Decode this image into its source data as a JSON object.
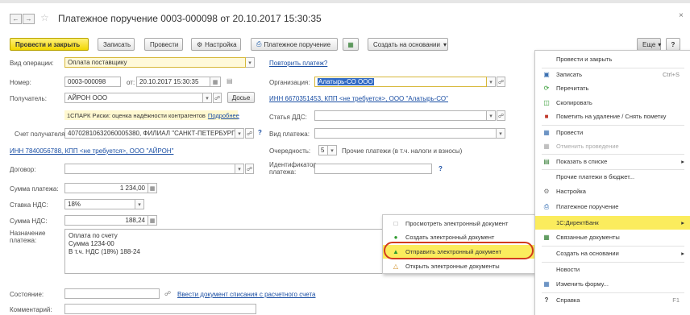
{
  "title": "Платежное поручение 0003-000098 от 20.10.2017 15:30:35",
  "toolbar": {
    "post_close": "Провести и закрыть",
    "save": "Записать",
    "post": "Провести",
    "settings": "Настройка",
    "payment_order": "Платежное поручение",
    "create_based": "Создать на основании",
    "more": "Еще",
    "help": "?"
  },
  "form": {
    "op_type_label": "Вид операции:",
    "op_type_value": "Оплата поставщику",
    "repeat_link": "Повторить платеж?",
    "number_label": "Номер:",
    "number_value": "0003-000098",
    "from_label": "от:",
    "date_value": "20.10.2017 15:30:35",
    "org_label": "Организация:",
    "org_value": "Алатырь-СО ООО",
    "recipient_label": "Получатель:",
    "recipient_value": "АЙРОН ООО",
    "dossier": "Досье",
    "org_inn_link": "ИНН 6670351453, КПП <не требуется>, ООО \"Алатырь-СО\"",
    "spark_text": "1СПАРК Риски: оценка надёжности контрагентов",
    "spark_more": "Подробнее",
    "dds_label": "Статья ДДС:",
    "account_label": "Счет получателя:",
    "account_value": "40702810632060005380, ФИЛИАЛ \"САНКТ-ПЕТЕРБУРГСКИ",
    "account_q": "?",
    "payment_kind_label": "Вид платежа:",
    "recipient_inn_link": "ИНН 7840056788, КПП <не требуется>, ООО \"АЙРОН\"",
    "queue_label": "Очередность:",
    "queue_value": "5",
    "queue_desc": "Прочие платежи (в т.ч. налоги и взносы)",
    "contract_label": "Договор:",
    "payment_id_label1": "Идентификатор",
    "payment_id_label2": "платежа:",
    "payment_id_q": "?",
    "amount_label": "Сумма платежа:",
    "amount_value": "1 234,00",
    "vat_rate_label": "Ставка НДС:",
    "vat_rate_value": "18%",
    "vat_label": "Сумма НДС:",
    "vat_value": "188,24",
    "purpose_label1": "Назначение",
    "purpose_label2": "платежа:",
    "purpose_line1": "Оплата по счету",
    "purpose_line2": "Сумма 1234-00",
    "purpose_line3": "В т.ч. НДС  (18%) 188-24",
    "state_label": "Состояние:",
    "write_off_link": "Ввести документ списания с расчетного счета",
    "comment_label": "Комментарий:"
  },
  "submenu": {
    "items": [
      {
        "label": "Просмотреть электронный документ"
      },
      {
        "label": "Создать электронный документ"
      },
      {
        "label": "Отправить электронный документ"
      },
      {
        "label": "Открыть электронные документы"
      }
    ]
  },
  "more_menu": {
    "post_close": "Провести и закрыть",
    "save": "Записать",
    "save_shortcut": "Ctrl+S",
    "reread": "Перечитать",
    "copy": "Скопировать",
    "mark_delete": "Пометить на удаление / Снять пометку",
    "post": "Провести",
    "cancel_post": "Отменить проведение",
    "show_in_list": "Показать в списке",
    "budget": "Прочие платежи в бюджет...",
    "settings": "Настройка",
    "payment_order": "Платежное поручение",
    "directbank": "1С:ДиректБанк",
    "related_docs": "Связанные документы",
    "create_based": "Создать на основании",
    "news": "Новости",
    "change_form": "Изменить форму...",
    "help": "Справка",
    "help_shortcut": "F1"
  },
  "colors": {
    "highlight": "#fbec5d",
    "link": "#1a4ea3",
    "primary_button": "#f2d600"
  }
}
